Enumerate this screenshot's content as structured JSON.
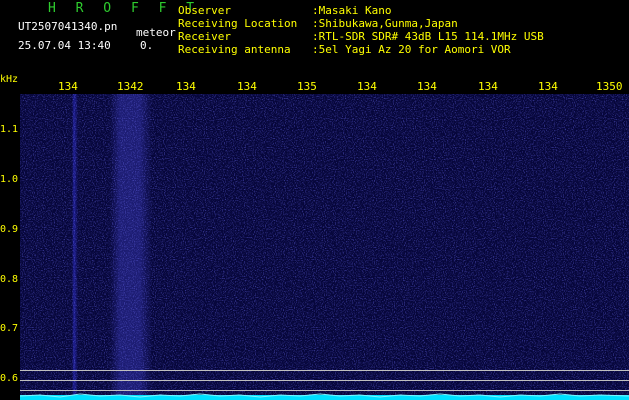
{
  "header": {
    "logo": "H R O F F T",
    "filename": "UT2507041340.pn",
    "tag": "meteor",
    "datetime": "25.07.04 13:40",
    "value": "0."
  },
  "info": [
    {
      "key": "Observer",
      "value": ":Masaki Kano"
    },
    {
      "key": "Receiving Location",
      "value": ":Shibukawa,Gunma,Japan"
    },
    {
      "key": "Receiver",
      "value": ":RTL-SDR SDR# 43dB L15 114.1MHz USB"
    },
    {
      "key": "Receiving antenna",
      "value": ":5el Yagi Az 20 for Aomori VOR"
    }
  ],
  "x_axis": {
    "ticks": [
      "134",
      "1342",
      "134",
      "134",
      "135",
      "134",
      "134",
      "134",
      "134",
      "1350"
    ]
  },
  "y_axis": {
    "unit": "kHz",
    "ticks": [
      "1.1",
      "1.0",
      "0.9",
      "0.8",
      "0.7",
      "0.6"
    ]
  },
  "colors": {
    "background": "#000000",
    "label": "#ffff00",
    "logo": "#2ecc2e",
    "waterfall": "#06063a",
    "spectrum": "#00e0ff"
  }
}
